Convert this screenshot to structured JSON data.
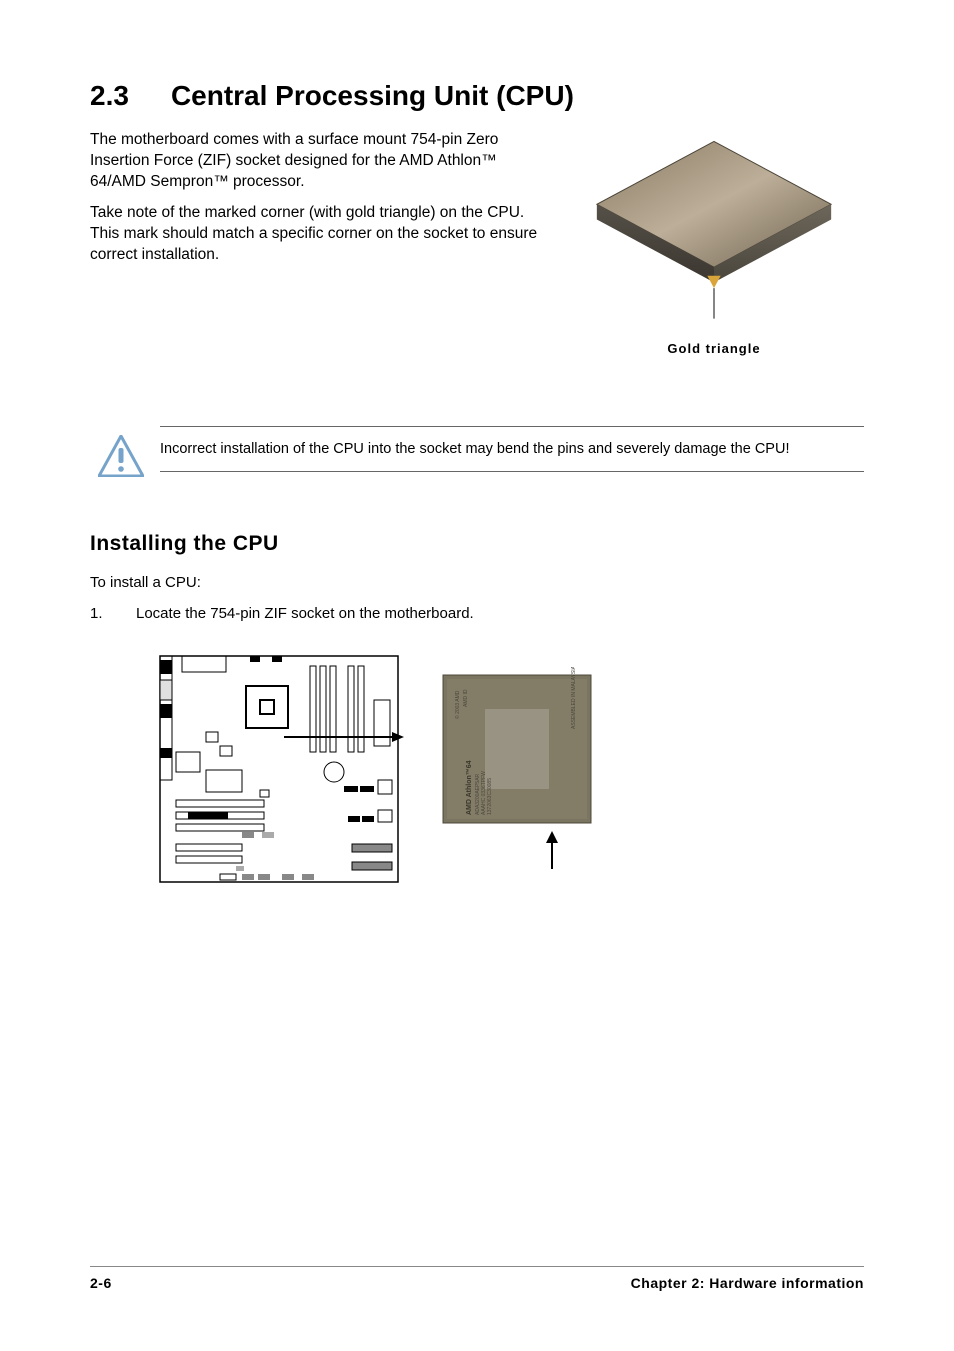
{
  "section": {
    "number": "2.3",
    "title": "Central Processing Unit (CPU)"
  },
  "intro": {
    "p1": "The motherboard comes with a surface mount 754-pin Zero Insertion Force (ZIF) socket designed for the AMD Athlon™ 64/AMD Sempron™ processor.",
    "p2": "Take note of the marked corner (with gold triangle) on the CPU. This mark should match a specific corner on the socket to ensure correct installation."
  },
  "cpu_image": {
    "gold_triangle_label": "Gold triangle"
  },
  "caution": {
    "text": "Incorrect installation of the CPU into the socket may bend the pins and severely damage the CPU!"
  },
  "install": {
    "heading": "Installing the CPU",
    "lead": "To install a CPU:",
    "step1_num": "1.",
    "step1_text": "Locate the 754-pin ZIF socket on the motherboard."
  },
  "chip_text": {
    "brand": "AMD Athlon™64",
    "sn1": "ADA3200AEP5AR",
    "sn2": "AAAHC 0336TPFW",
    "sn3": "1372063C30085",
    "asm": "ASSEMBLED IN MALAYSIA",
    "copy": "© 2003 AMD",
    "diff": "AMD ID"
  },
  "footer": {
    "page": "2-6",
    "chapter": "Chapter 2: Hardware information"
  }
}
